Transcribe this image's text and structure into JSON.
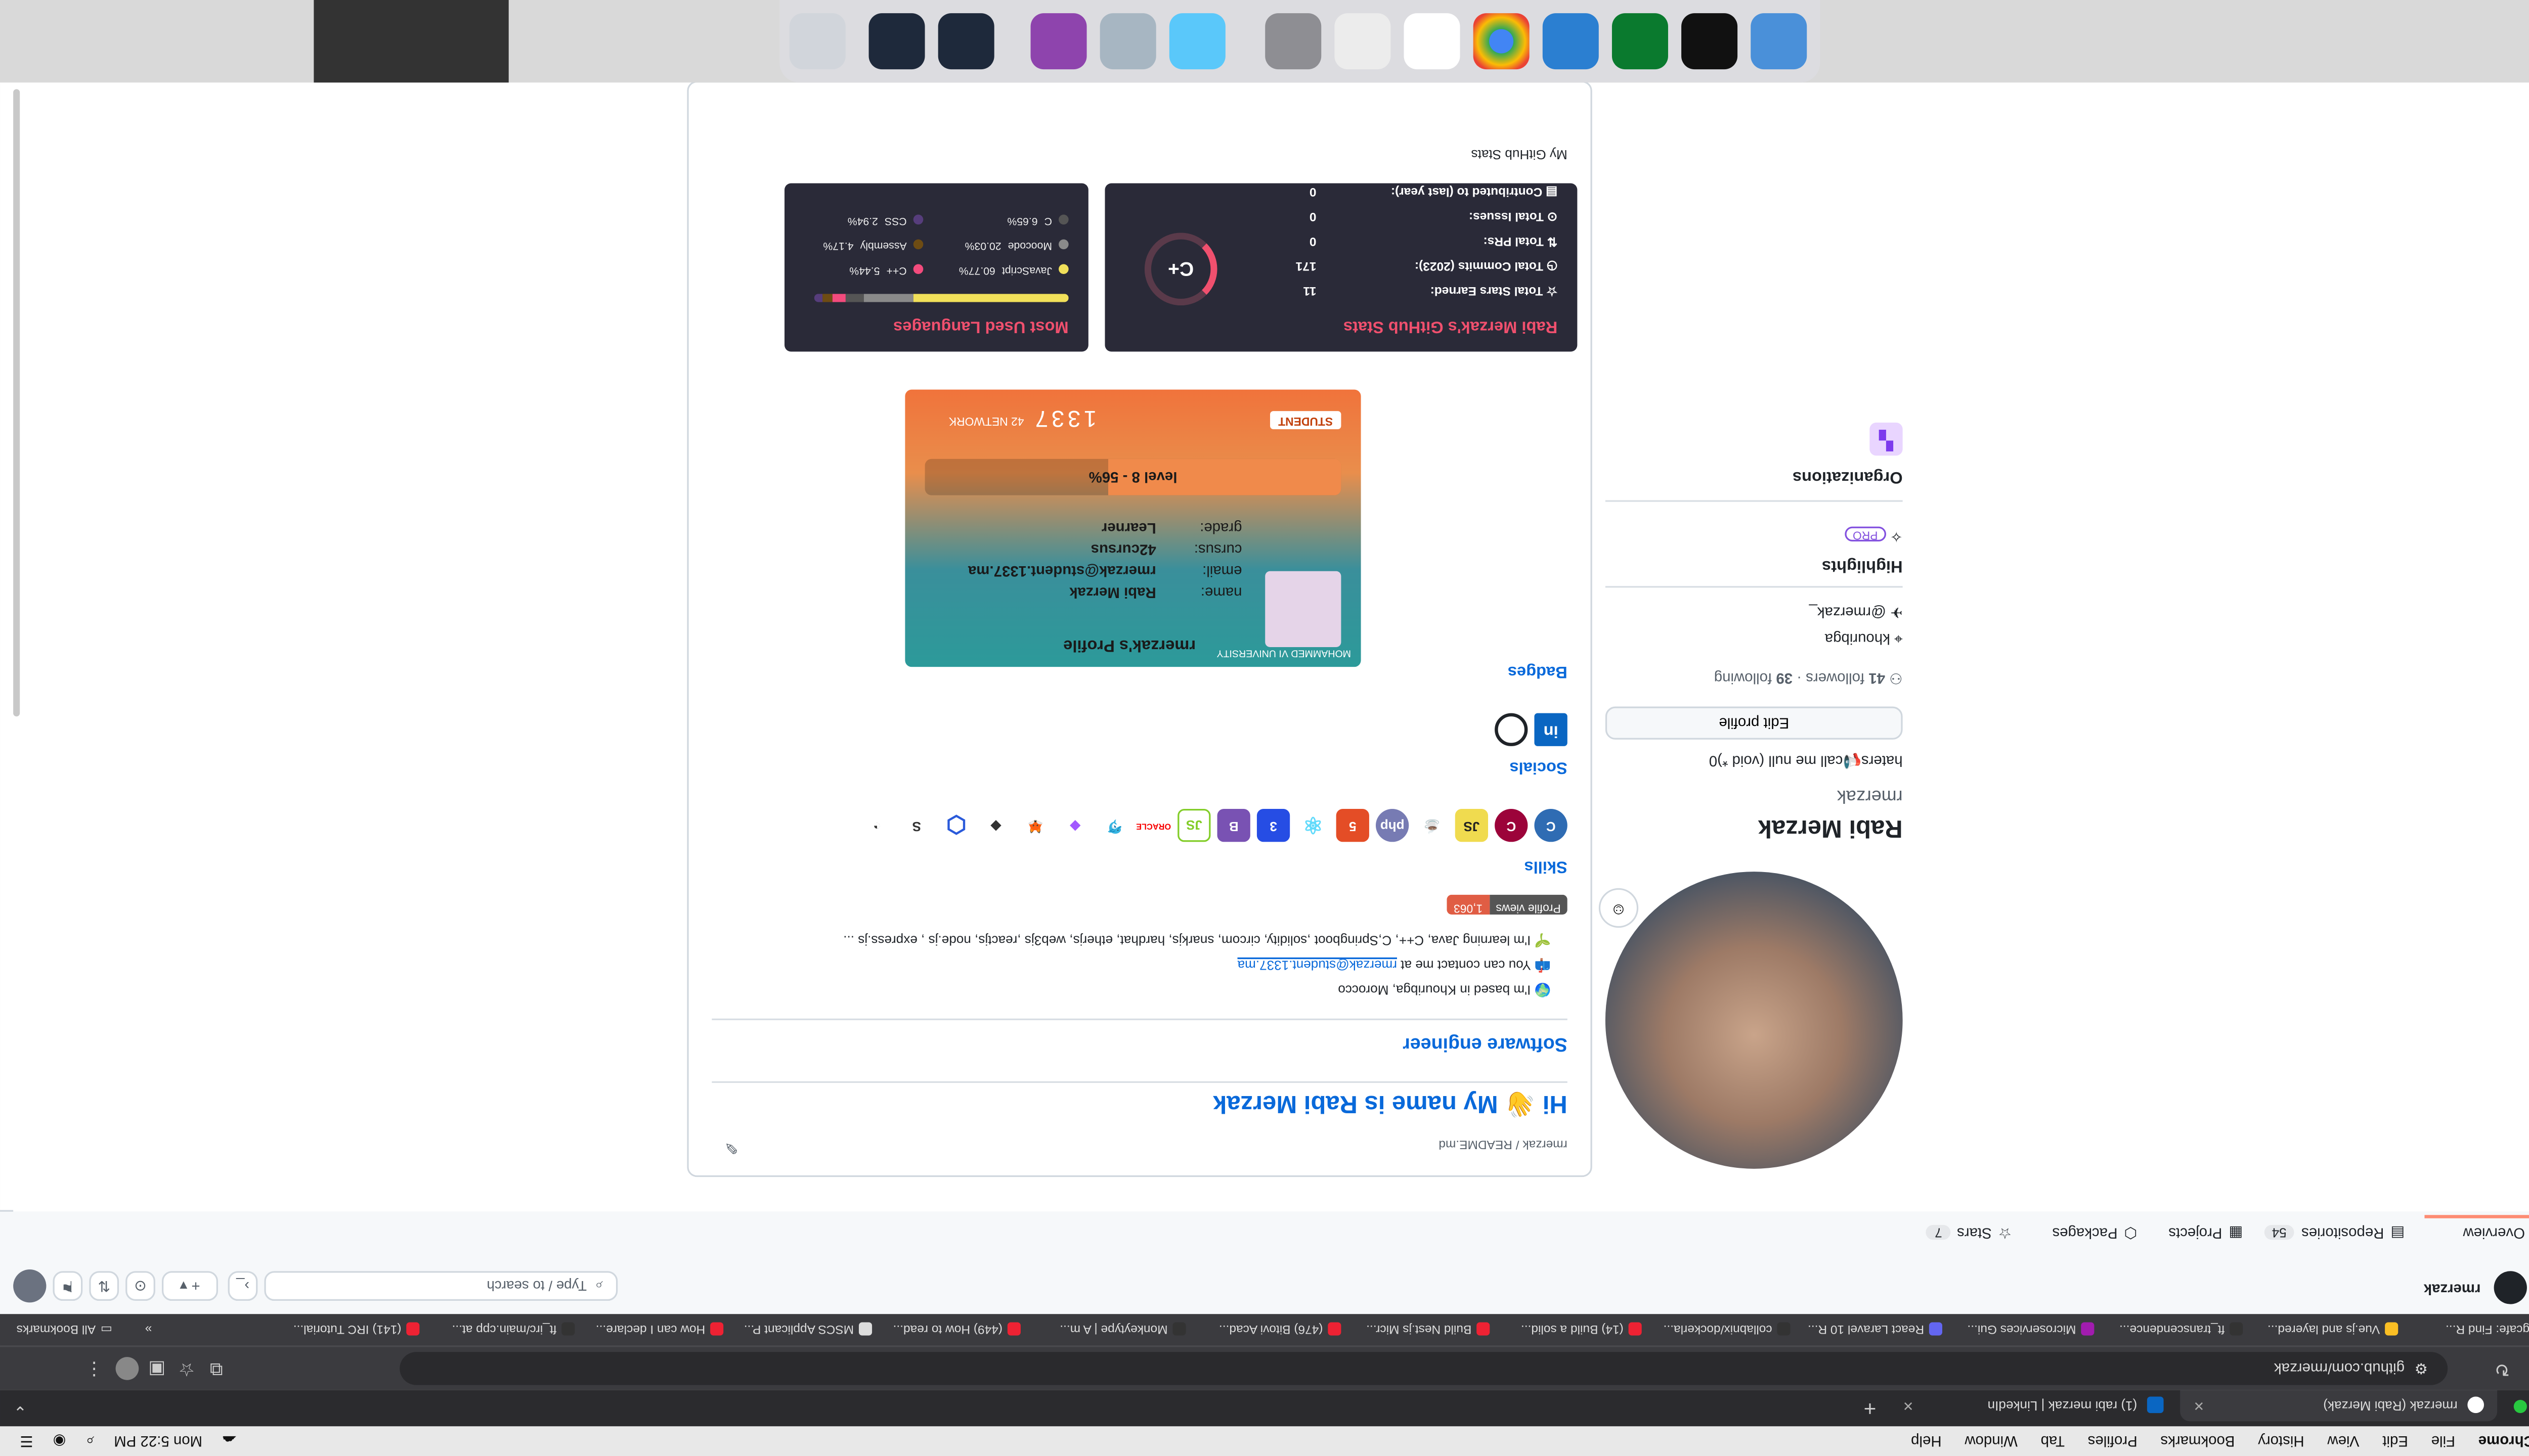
{
  "menubar": {
    "app": "Chrome",
    "items": [
      "File",
      "Edit",
      "View",
      "History",
      "Bookmarks",
      "Profiles",
      "Tab",
      "Window",
      "Help"
    ],
    "clock": "Mon 5:22 PM"
  },
  "tabs": [
    {
      "title": "rmerzak (Rabi Merzak)",
      "active": true
    },
    {
      "title": "(1) rabi merzak | LinkedIn",
      "active": false
    }
  ],
  "omnibox": {
    "url": "github.com/rmerzak"
  },
  "bookmarks": {
    "items": [
      "Hiringcafe: Find R...",
      "Vue.js and layered...",
      "ft_transcendence...",
      "Microservices Gui...",
      "React Laravel 10 R...",
      "collabnix/dockerla...",
      "(14) Build a solid...",
      "Build Nest.js Micr...",
      "(476) Bitovi Acad...",
      "Monkeytype | A m...",
      "(449) How to read...",
      "MSCS Applicant P...",
      "How can I declare...",
      "ft_irc/main.cpp at...",
      "(141) IRC Tutorial..."
    ],
    "more": "»",
    "all": "All Bookmarks"
  },
  "github": {
    "username": "rmerzak",
    "search_placeholder": "Type / to search",
    "nav": [
      {
        "label": "Overview",
        "count": ""
      },
      {
        "label": "Repositories",
        "count": "54"
      },
      {
        "label": "Projects",
        "count": ""
      },
      {
        "label": "Packages",
        "count": ""
      },
      {
        "label": "Stars",
        "count": "7"
      }
    ]
  },
  "profile": {
    "name": "Rabi Merzak",
    "login": "rmerzak",
    "bio": "haters📢call me null (void *)0",
    "edit_button": "Edit profile",
    "followers": "41",
    "followers_label": "followers",
    "following": "39",
    "following_label": "following",
    "location": "khouribga",
    "twitter": "@rmerzak_",
    "highlights_title": "Highlights",
    "pro_badge": "PRO",
    "organizations_title": "Organizations"
  },
  "readme": {
    "path": "rmerzak / README.md",
    "heading": "Hi 👋 My name is Rabi Merzak",
    "subtitle": "Software engineer",
    "bullets": [
      "🌍 I'm based in Khouribga, Morocco",
      "📫 You can contact me at",
      "🌱 I'm learning Java, C++, C,Springboot ,solidity, circom, snarkjs, hardhat, etherjs, web3js ,reactjs, node.js , express.js ..."
    ],
    "email": "rmerzak@student.1337.ma",
    "views_label": "Profile views",
    "views_count": "1,063",
    "skills_title": "Skills",
    "socials_title": "Socials",
    "badges_title": "Badges",
    "stats_caption": "My GitHub Stats"
  },
  "skills_icons": [
    "c-icon",
    "cpp-icon",
    "javascript-icon",
    "java-icon",
    "php-icon",
    "html5-icon",
    "react-icon",
    "css3-icon",
    "bootstrap-icon",
    "nodejs-icon",
    "oracle-icon",
    "mysql-icon",
    "figma-icon",
    "metamask-icon",
    "ethereum-icon",
    "chainlink-icon",
    "solidity-icon",
    "docker-icon"
  ],
  "card42": {
    "title": "rmerzak's Profile",
    "name_label": "name:",
    "name": "Rabi Merzak",
    "email_label": "email:",
    "email": "rmerzak@student.1337.ma",
    "cursus_label": "cursus:",
    "cursus": "42cursus",
    "grade_label": "grade:",
    "grade": "Learner",
    "level": "level 8 - 56%",
    "campus": "1337",
    "network": "42 NETWORK",
    "student": "STUDENT",
    "university": "MOHAMMED VI UNIVERSITY",
    "level_progress": 56
  },
  "stats": {
    "title": "Rabi Merzak's GitHub Stats",
    "rows": [
      {
        "label": "Total Stars Earned:",
        "value": "11"
      },
      {
        "label": "Total Commits (2023):",
        "value": "171"
      },
      {
        "label": "Total PRs:",
        "value": "0"
      },
      {
        "label": "Total Issues:",
        "value": "0"
      },
      {
        "label": "Contributed to (last year):",
        "value": "0"
      }
    ],
    "grade": "C+"
  },
  "languages": {
    "title": "Most Used Languages",
    "items": [
      {
        "name": "JavaScript",
        "pct": "60.77%",
        "color": "#f1e05a"
      },
      {
        "name": "Moocode",
        "pct": "20.03%",
        "color": "#8a8a8a"
      },
      {
        "name": "C",
        "pct": "6.65%",
        "color": "#555555"
      },
      {
        "name": "C++",
        "pct": "5.44%",
        "color": "#f34b7d"
      },
      {
        "name": "Assembly",
        "pct": "4.17%",
        "color": "#6e4c13"
      },
      {
        "name": "CSS",
        "pct": "2.94%",
        "color": "#563d7c"
      }
    ],
    "bar": [
      60.77,
      20.03,
      6.65,
      5.44,
      4.17,
      2.94
    ]
  },
  "colors": {
    "link": "#0969da",
    "accent": "#fd8c73",
    "stats_bg": "#2a2a38",
    "stats_title": "#f0506e"
  }
}
